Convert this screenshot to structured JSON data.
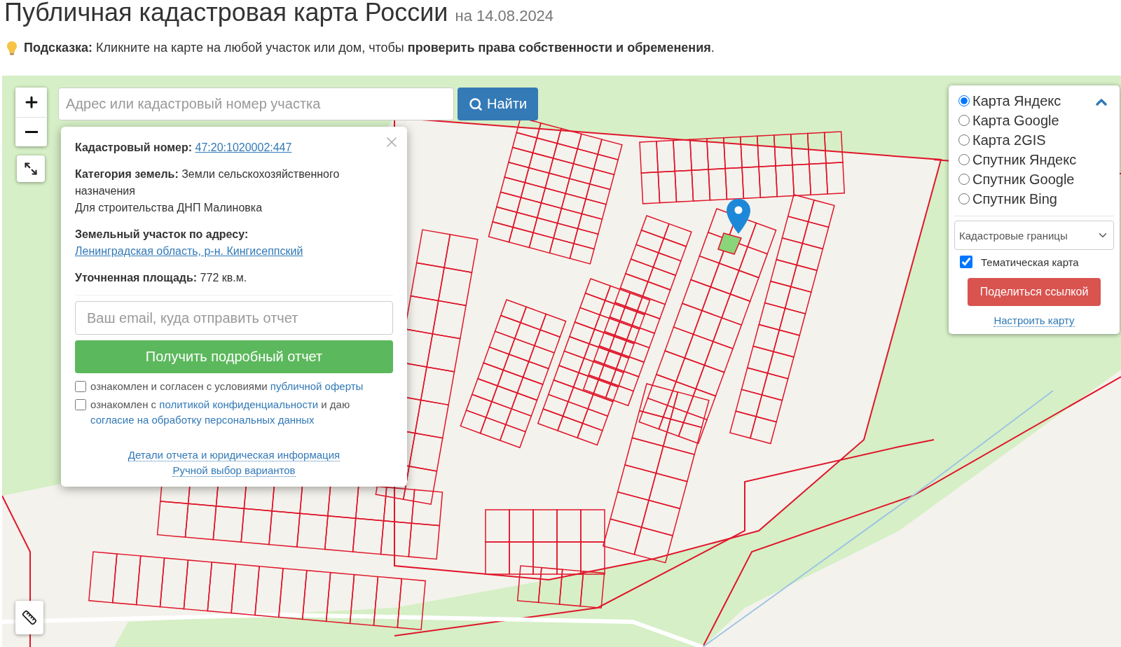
{
  "header": {
    "title": "Публичная кадастровая карта России",
    "date": "на 14.08.2024",
    "hint": "**Подсказка:** Кликните на карте на любой участок или дом, чтобы **проверить права собственности и обременения**."
  },
  "search": {
    "placeholder": "Адрес или кадастровый номер участка",
    "button": "Найти"
  },
  "popup": {
    "items": [
      {
        "kind": "link_field",
        "label": "Кадастровый номер:",
        "value": "47:20:1020002:447"
      },
      {
        "kind": "field",
        "label": "Категория земель:",
        "value": "Земли сельскохозяйственного назначения"
      },
      {
        "kind": "note",
        "text": "Для строительства ДНП Малиновка"
      },
      {
        "kind": "link_field",
        "label": "Земельный участок по адресу:",
        "value": "Ленинградская область, р-н. Кингисеппский"
      },
      {
        "kind": "field",
        "label": "Уточненная площадь:",
        "value": "772 кв.м."
      }
    ],
    "email_placeholder": "Ваш email, куда отправить отчет",
    "report_button": "Получить подробный отчет",
    "consents": [
      {
        "checked": false,
        "parts": [
          {
            "kind": "text",
            "text": "ознакомлен и согласен с условиями"
          },
          {
            "kind": "link",
            "text": "публичной оферты"
          }
        ]
      },
      {
        "checked": false,
        "parts": [
          {
            "kind": "text",
            "text": "ознакомлен с"
          },
          {
            "kind": "link",
            "text": "политикой конфиденциальности"
          },
          {
            "kind": "text",
            "text": "и даю"
          },
          {
            "kind": "link",
            "text": "согласие на обработку персональных данных"
          }
        ]
      }
    ],
    "footer_links": [
      "Детали отчета и юридическая информация",
      "Ручной выбор вариантов"
    ]
  },
  "layers": {
    "expanded": true,
    "options": [
      {
        "label": "Карта Яндекс",
        "selected": true
      },
      {
        "label": "Карта Google",
        "selected": false
      },
      {
        "label": "Карта 2GIS",
        "selected": false
      },
      {
        "label": "Спутник Яндекс",
        "selected": false
      },
      {
        "label": "Спутник Google",
        "selected": false
      },
      {
        "label": "Спутник Bing",
        "selected": false
      }
    ],
    "overlay_select": "Кадастровые границы",
    "thematic": {
      "label": "Тематическая карта",
      "checked": true
    },
    "share_button": "Поделиться ссылкой",
    "settings_link": "Настроить карту"
  }
}
